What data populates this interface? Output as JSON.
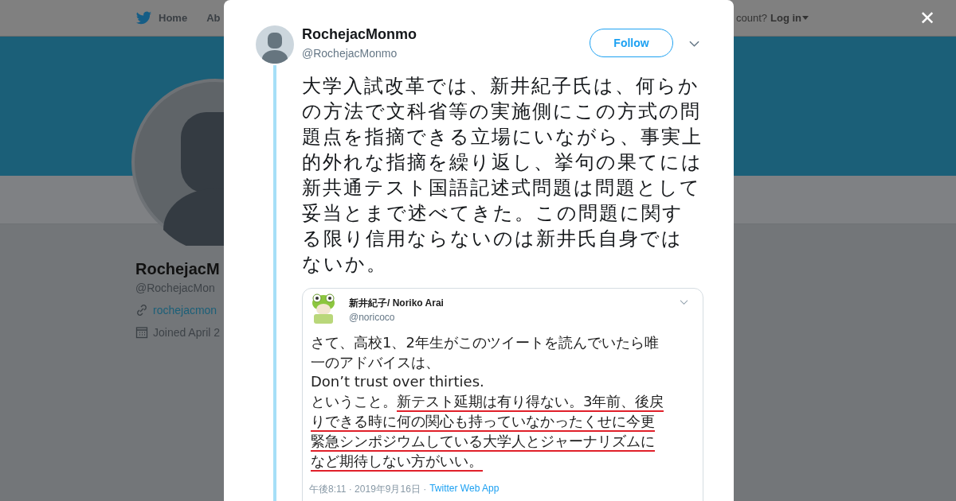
{
  "background_page": {
    "nav": {
      "home": "Home",
      "about": "Ab",
      "account_prompt": "count?",
      "login": "Log in"
    },
    "profile": {
      "name": "RochejacM",
      "handle": "@RochejacMon",
      "link": "rochejacmon",
      "joined": "Joined April 2"
    }
  },
  "tweet": {
    "author": {
      "name": "RochejacMonmo",
      "handle": "@RochejacMonmo"
    },
    "follow_button": "Follow",
    "text": "大学入試改革では、新井紀子氏は、何らかの方法で文科省等の実施側にこの方式の問題点を指摘できる立場にいながら、事実上的外れな指摘を繰り返し、挙句の果てには新共通テスト国語記述式問題は問題として妥当とまで述べてきた。この問題に関する限り信用ならないのは新井氏自身ではないか。",
    "embedded_screenshot": {
      "author": {
        "name": "新井紀子/ Noriko Arai",
        "handle": "@noricoco"
      },
      "lines": [
        [
          {
            "text": "さて、高校1、2年生がこのツイートを読んでいたら唯",
            "underlined": false
          }
        ],
        [
          {
            "text": "一のアドバイスは、",
            "underlined": false
          }
        ],
        [
          {
            "text": "Don’t trust over thirties.",
            "underlined": false
          }
        ],
        [
          {
            "text": "ということ。",
            "underlined": false
          },
          {
            "text": "新テスト延期は有り得ない。",
            "underlined": true
          },
          {
            "text": "3年前、後戻",
            "underlined": true
          }
        ],
        [
          {
            "text": "りできる時に何の関心も持っていなかったくせに今更",
            "underlined": true
          }
        ],
        [
          {
            "text": "緊急シンポジウムしている大学人とジャーナリズムに",
            "underlined": true
          }
        ],
        [
          {
            "text": "など期待しない方がいい。",
            "underlined": true
          }
        ]
      ],
      "meta": "午後8:11 · 2019年9月16日 ·",
      "source": "Twitter Web App"
    }
  },
  "close_button": "✕"
}
